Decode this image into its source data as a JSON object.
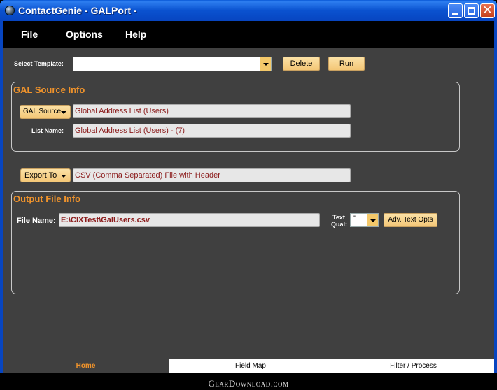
{
  "window": {
    "title": "ContactGenie - GALPort -",
    "buttons": [
      "minimize",
      "maximize",
      "close"
    ],
    "close_glyph": "✕"
  },
  "menu": {
    "items": [
      {
        "label": "File"
      },
      {
        "label": "Options"
      },
      {
        "label": "Help"
      }
    ]
  },
  "template": {
    "label": "Select Template:",
    "value": "",
    "delete_label": "Delete",
    "run_label": "Run"
  },
  "gal_source": {
    "title": "GAL Source Info",
    "source_button": "GAL Source",
    "source_value": "Global Address List (Users)",
    "list_name_label": "List Name:",
    "list_name_value": "Global Address List (Users) - (7)"
  },
  "export": {
    "button": "Export To",
    "value": "CSV (Comma Separated) File with Header"
  },
  "output_file": {
    "title": "Output File Info",
    "file_name_label": "File Name:",
    "file_name_value": "E:\\CIXTest\\GalUsers.csv",
    "text_qual_label_1": "Text",
    "text_qual_label_2": "Qual:",
    "text_qual_value": "\"",
    "adv_button": "Adv. Text Opts"
  },
  "tabs": [
    {
      "label": "Home",
      "active": true
    },
    {
      "label": "Field Map",
      "active": false
    },
    {
      "label": "Filter / Process",
      "active": false
    }
  ],
  "watermark": "GearDownload.com",
  "colors": {
    "accent": "#f0932b",
    "panel": "#404040",
    "field_text": "#8b1a1a",
    "button": "#f4c777"
  }
}
